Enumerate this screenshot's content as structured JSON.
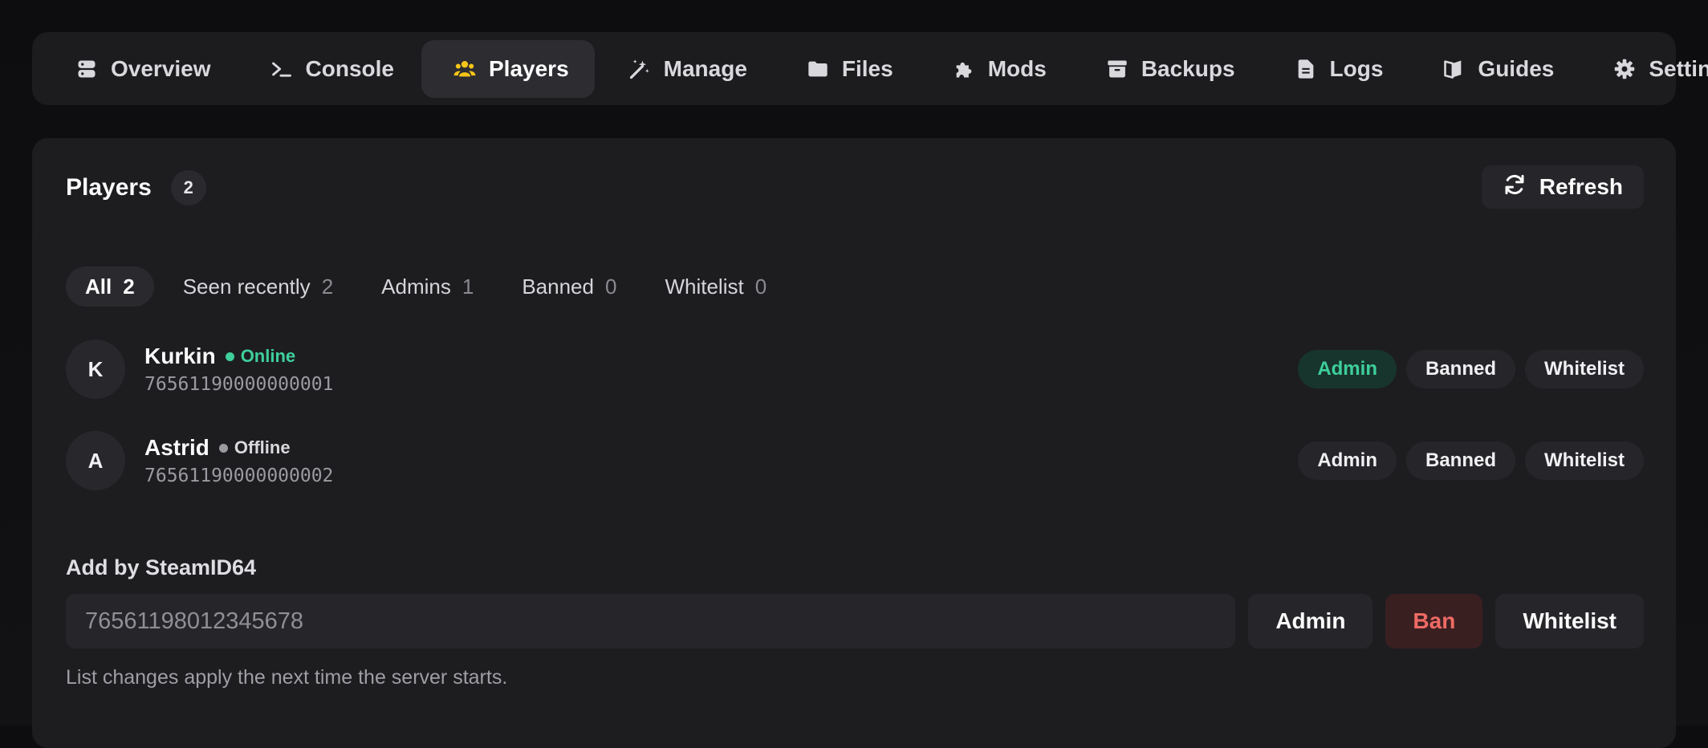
{
  "nav": {
    "tabs": [
      {
        "label": "Overview",
        "icon": "server-icon"
      },
      {
        "label": "Console",
        "icon": "terminal-icon"
      },
      {
        "label": "Players",
        "icon": "users-icon",
        "active": true
      },
      {
        "label": "Manage",
        "icon": "magic-wand-icon"
      },
      {
        "label": "Files",
        "icon": "folder-icon"
      },
      {
        "label": "Mods",
        "icon": "puzzle-icon"
      },
      {
        "label": "Backups",
        "icon": "archive-icon"
      },
      {
        "label": "Logs",
        "icon": "file-text-icon"
      },
      {
        "label": "Guides",
        "icon": "book-icon"
      },
      {
        "label": "Settings",
        "icon": "gear-icon"
      }
    ],
    "active_color": "#f5c518"
  },
  "panel": {
    "title": "Players",
    "count": "2",
    "refresh_label": "Refresh"
  },
  "filters": [
    {
      "label": "All",
      "count": "2",
      "active": true
    },
    {
      "label": "Seen recently",
      "count": "2"
    },
    {
      "label": "Admins",
      "count": "1"
    },
    {
      "label": "Banned",
      "count": "0"
    },
    {
      "label": "Whitelist",
      "count": "0"
    }
  ],
  "players": [
    {
      "initial": "K",
      "name": "Kurkin",
      "status": "Online",
      "status_color": "#3ecf9b",
      "steamid": "76561190000000001",
      "roles": {
        "admin": "Admin",
        "banned": "Banned",
        "whitelist": "Whitelist"
      },
      "admin_active": true
    },
    {
      "initial": "A",
      "name": "Astrid",
      "status": "Offline",
      "status_color": "#9a9aa0",
      "steamid": "76561190000000002",
      "roles": {
        "admin": "Admin",
        "banned": "Banned",
        "whitelist": "Whitelist"
      },
      "admin_active": false
    }
  ],
  "add": {
    "label": "Add by SteamID64",
    "placeholder": "76561198012345678",
    "admin_label": "Admin",
    "ban_label": "Ban",
    "whitelist_label": "Whitelist",
    "note": "List changes apply the next time the server starts."
  },
  "colors": {
    "accent": "#f5c518",
    "online": "#3ecf9b",
    "danger": "#ef6a64"
  }
}
